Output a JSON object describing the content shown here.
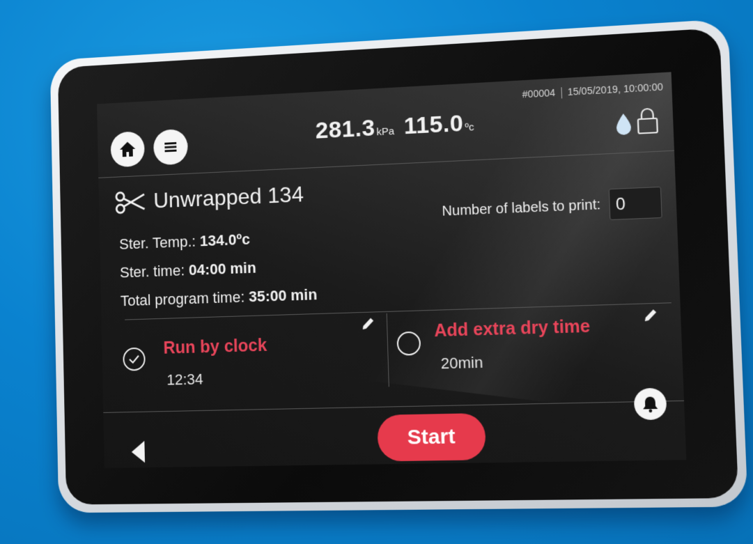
{
  "header": {
    "pressure_value": "281.3",
    "pressure_unit": "kPa",
    "temp_value": "115.0",
    "temp_unit": "ºc",
    "cycle_number": "#00004",
    "datetime": "15/05/2019, 10:00:00",
    "icons": [
      "home-icon",
      "menu-icon",
      "water-drop-icon",
      "lock-icon"
    ]
  },
  "program": {
    "name": "Unwrapped 134",
    "icon": "scissors-icon",
    "ster_temp_label": "Ster. Temp.: ",
    "ster_temp_value": "134.0ºc",
    "ster_time_label": "Ster. time: ",
    "ster_time_value": "04:00 min",
    "total_time_label": "Total program time: ",
    "total_time_value": "35:00 min",
    "labels_to_print_label": "Number of labels to print:",
    "labels_to_print_value": "0"
  },
  "options": {
    "run_by_clock": {
      "title": "Run by clock",
      "value": "12:34",
      "checked": true
    },
    "extra_dry": {
      "title": "Add extra dry time",
      "value": "20min",
      "checked": false
    }
  },
  "footer": {
    "start_label": "Start",
    "icons": [
      "back-arrow-icon",
      "bell-icon"
    ]
  },
  "colors": {
    "accent_red": "#e63a4c",
    "option_title_red": "#e8455a",
    "background_blue": "#0a82cf",
    "screen_dark": "#1b1b1b"
  }
}
